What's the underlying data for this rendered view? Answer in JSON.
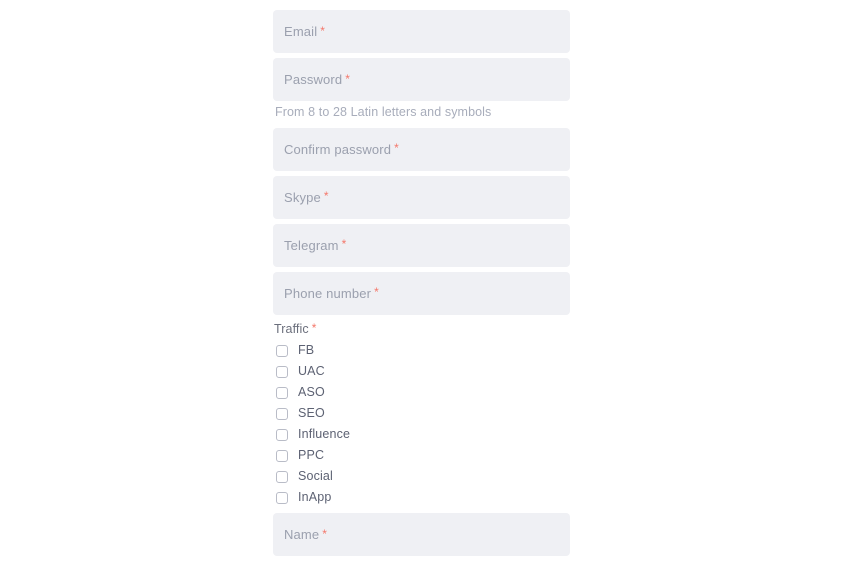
{
  "form": {
    "required_marker": "*",
    "fields": [
      {
        "name": "email",
        "placeholder": "Email",
        "required": true
      },
      {
        "name": "password",
        "placeholder": "Password",
        "required": true
      },
      {
        "name": "confirm-password",
        "placeholder": "Confirm password",
        "required": true
      },
      {
        "name": "skype",
        "placeholder": "Skype",
        "required": true
      },
      {
        "name": "telegram",
        "placeholder": "Telegram",
        "required": true
      },
      {
        "name": "phone-number",
        "placeholder": "Phone number",
        "required": true
      }
    ],
    "password_hint": "From 8 to 28 Latin letters and symbols",
    "traffic": {
      "label": "Traffic",
      "required": true,
      "options": [
        {
          "label": "FB",
          "checked": false
        },
        {
          "label": "UAC",
          "checked": false
        },
        {
          "label": "ASO",
          "checked": false
        },
        {
          "label": "SEO",
          "checked": false
        },
        {
          "label": "Influence",
          "checked": false
        },
        {
          "label": "PPC",
          "checked": false
        },
        {
          "label": "Social",
          "checked": false
        },
        {
          "label": "InApp",
          "checked": false
        }
      ]
    },
    "name_field": {
      "placeholder": "Name",
      "required": true
    }
  },
  "colors": {
    "page_background": "#ffffff",
    "input_background": "#eff0f4",
    "placeholder_text": "#9ba0ae",
    "helper_text": "#a8adbb",
    "label_text": "#6b6f7c",
    "checkbox_label_text": "#5d6273",
    "checkbox_border": "#b9bcc7",
    "required_asterisk": "#f4776a"
  }
}
